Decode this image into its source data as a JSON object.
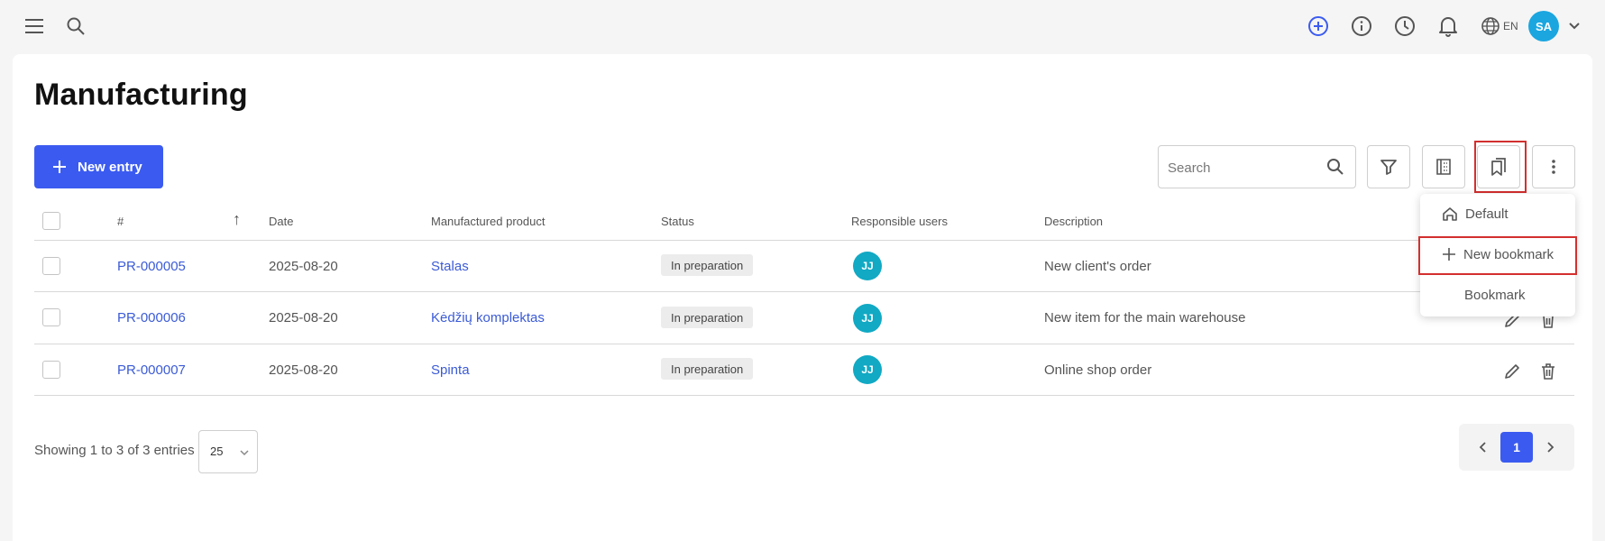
{
  "header": {
    "language": "EN",
    "user_initials": "SA",
    "accent_color": "#3b5bf0"
  },
  "page": {
    "title": "Manufacturing",
    "new_entry_label": "New entry",
    "search_placeholder": "Search"
  },
  "table": {
    "columns": [
      "#",
      "Date",
      "Manufactured product",
      "Status",
      "Responsible users",
      "Description"
    ],
    "sort_indicator": "↑",
    "rows": [
      {
        "id": "PR-000005",
        "date": "2025-08-20",
        "product": "Stalas",
        "status": "In preparation",
        "user": "JJ",
        "description": "New client's order"
      },
      {
        "id": "PR-000006",
        "date": "2025-08-20",
        "product": "Kėdžių komplektas",
        "status": "In preparation",
        "user": "JJ",
        "description": "New item for the main warehouse"
      },
      {
        "id": "PR-000007",
        "date": "2025-08-20",
        "product": "Spinta",
        "status": "In preparation",
        "user": "JJ",
        "description": "Online shop order"
      }
    ]
  },
  "bookmarks_menu": {
    "items": [
      "Default",
      "New bookmark",
      "Bookmark"
    ]
  },
  "footer": {
    "showing": "Showing 1 to 3 of 3 entries",
    "per_page": "25",
    "current_page": "1"
  }
}
